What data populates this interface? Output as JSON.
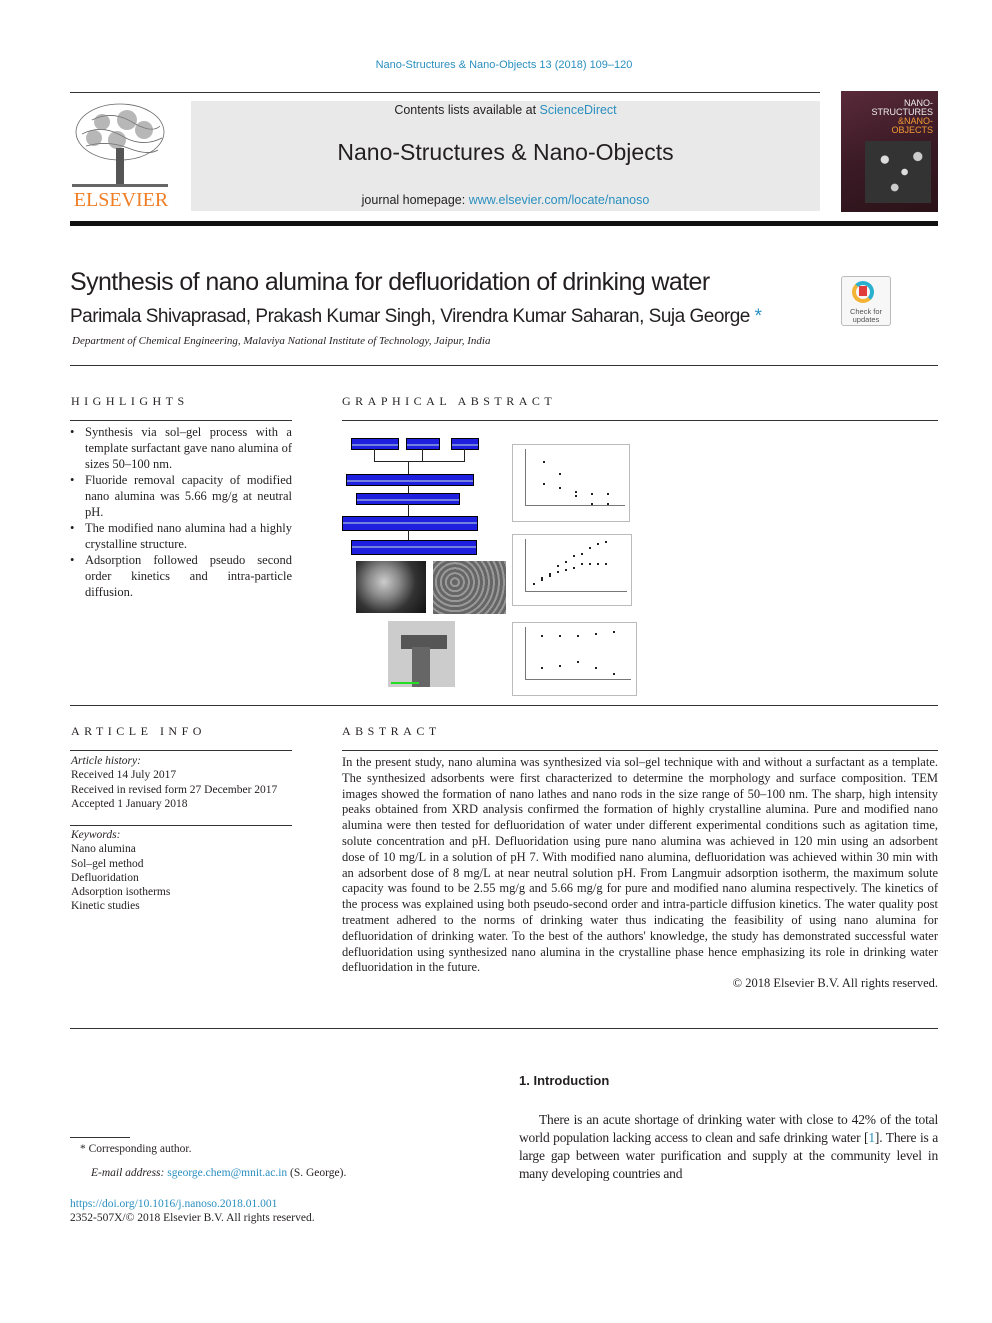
{
  "header": {
    "journal_reference": "Nano-Structures & Nano-Objects 13 (2018) 109–120",
    "publisher_logo_text": "ELSEVIER",
    "contents_prefix": "Contents lists available at ",
    "contents_link": "ScienceDirect",
    "journal_title": "Nano-Structures & Nano-Objects",
    "homepage_prefix": "journal homepage: ",
    "homepage_link": "www.elsevier.com/locate/nanoso",
    "cover_lines": [
      "NANO-",
      "STRUCTURES",
      "&NANO-",
      "OBJECTS"
    ]
  },
  "article": {
    "title": "Synthesis of nano alumina for defluoridation of drinking water",
    "authors": "Parimala Shivaprasad, Prakash Kumar Singh, Virendra Kumar Saharan, Suja George",
    "corresponding_mark": "*",
    "affiliation": "Department of Chemical Engineering, Malaviya National Institute of Technology, Jaipur, India",
    "check_updates": [
      "Check for",
      "updates"
    ]
  },
  "highlights": {
    "heading": "HIGHLIGHTS",
    "items": [
      "Synthesis via sol–gel process with a template surfactant gave nano alumina of sizes 50–100 nm.",
      "Fluoride removal capacity of modified nano alumina was 5.66 mg/g at neutral pH.",
      "The modified nano alumina had a highly crystalline structure.",
      "Adsorption followed pseudo second order kinetics and intra-particle diffusion."
    ]
  },
  "graphical_abstract": {
    "heading": "GRAPHICAL ABSTRACT"
  },
  "article_info": {
    "heading": "ARTICLE INFO",
    "history_label": "Article history:",
    "history": [
      "Received 14 July 2017",
      "Received in revised form 27 December 2017",
      "Accepted 1 January 2018"
    ],
    "keywords_label": "Keywords:",
    "keywords": [
      "Nano alumina",
      "Sol–gel method",
      "Defluoridation",
      "Adsorption isotherms",
      "Kinetic studies"
    ]
  },
  "abstract": {
    "heading": "ABSTRACT",
    "text": "In the present study, nano alumina was synthesized via sol–gel technique with and without a surfactant as a template. The synthesized adsorbents were first characterized to determine the morphology and surface composition. TEM images showed the formation of nano lathes and nano rods in the size range of 50–100 nm. The sharp, high intensity peaks obtained from XRD analysis confirmed the formation of highly crystalline alumina. Pure and modified nano alumina were then tested for defluoridation of water under different experimental conditions such as agitation time, solute concentration and pH. Defluoridation using pure nano alumina was achieved in 120 min using an adsorbent dose of 10 mg/L in a solution of pH 7. With modified nano alumina, defluoridation was achieved within 30 min with an adsorbent dose of 8 mg/L at near neutral solution pH. From Langmuir adsorption isotherm, the maximum solute capacity was found to be 2.55 mg/g and 5.66 mg/g for pure and modified nano alumina respectively. The kinetics of the process was explained using both pseudo-second order and intra-particle diffusion kinetics. The water quality post treatment adhered to the norms of drinking water thus indicating the feasibility of using nano alumina for defluoridation of drinking water. To the best of the authors' knowledge, the study has demonstrated successful water defluoridation using synthesized nano alumina in the crystalline phase hence emphasizing its role in drinking water defluoridation in the future.",
    "copyright": "© 2018 Elsevier B.V. All rights reserved."
  },
  "introduction": {
    "heading": "1. Introduction",
    "text_before_ref": "There is an acute shortage of drinking water with close to 42% of the total world population lacking access to clean and safe drinking water [",
    "ref": "1",
    "text_after_ref": "]. There is a large gap between water purification and supply at the community level in many developing countries and"
  },
  "footnotes": {
    "corresponding": "* Corresponding author.",
    "email_label": "E-mail address: ",
    "email": "sgeorge.chem@mnit.ac.in",
    "email_suffix": " (S. George).",
    "doi": "https://doi.org/10.1016/j.nanoso.2018.01.001",
    "issn": "2352-507X/© 2018 Elsevier B.V. All rights reserved."
  },
  "colors": {
    "link": "#2a8fbf",
    "elsevier_orange": "#f07e26",
    "flowchart_blue": "#1f1fe0"
  }
}
